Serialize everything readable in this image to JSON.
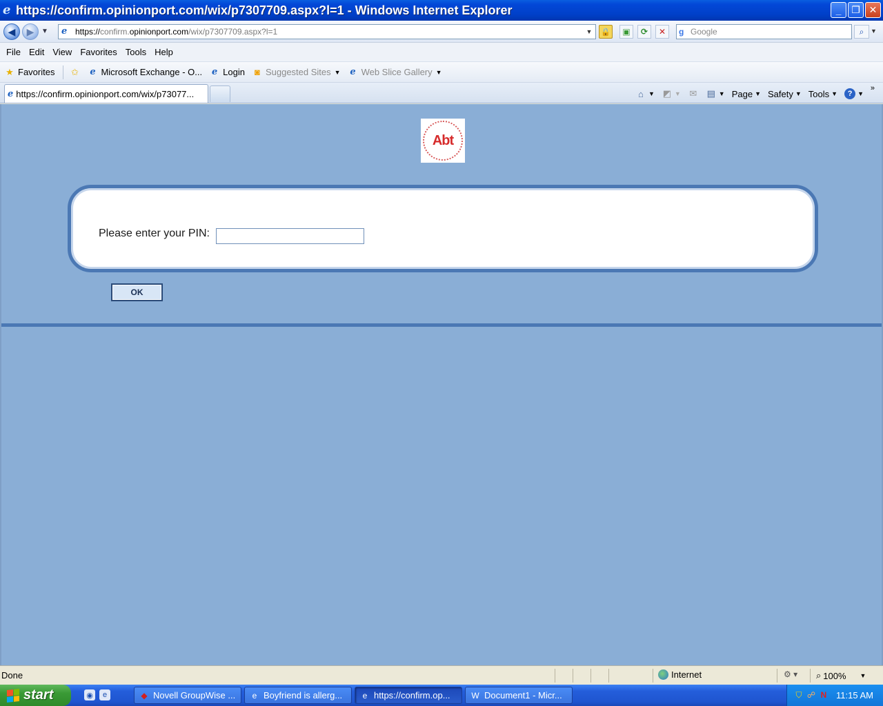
{
  "window": {
    "title": "https://confirm.opinionport.com/wix/p7307709.aspx?l=1 - Windows Internet Explorer",
    "minimize": "_",
    "restore": "❐",
    "close": "✕"
  },
  "address": {
    "url_prefix": "https://",
    "url_dim1": "confirm.",
    "url_host": "opinionport.com",
    "url_dim2": "/wix/p7307709.aspx?l=1",
    "search_placeholder": "Google"
  },
  "menu": [
    "File",
    "Edit",
    "View",
    "Favorites",
    "Tools",
    "Help"
  ],
  "favorites_bar": {
    "favorites_label": "Favorites",
    "items": [
      {
        "label": "Microsoft Exchange - O...",
        "icon": "ie-page-icon"
      },
      {
        "label": "Login",
        "icon": "ie-page-icon"
      },
      {
        "label": "Suggested Sites",
        "icon": "suggested-sites-icon"
      },
      {
        "label": "Web Slice Gallery",
        "icon": "ie-page-icon"
      }
    ]
  },
  "tabs": {
    "active_label": "https://confirm.opinionport.com/wix/p73077..."
  },
  "commands": {
    "page": "Page",
    "safety": "Safety",
    "tools": "Tools",
    "help": "?"
  },
  "page": {
    "logo_text": "Abt",
    "pin_label": "Please enter your PIN:",
    "pin_value": "",
    "ok_label": "OK"
  },
  "status": {
    "text": "Done",
    "zone": "Internet",
    "zoom": "100%"
  },
  "taskbar": {
    "start_label": "start",
    "tasks": [
      {
        "label": "Novell GroupWise ...",
        "icon": "groupwise-icon"
      },
      {
        "label": "Boyfriend is allerg...",
        "icon": "ie-icon"
      },
      {
        "label": "https://confirm.op...",
        "icon": "ie-icon"
      },
      {
        "label": "Document1 - Micr...",
        "icon": "word-icon"
      }
    ],
    "clock": "11:15 AM"
  },
  "colors": {
    "page_background": "#8aaed6",
    "panel_border": "#4b78b4",
    "logo_red": "#d62b2b"
  }
}
